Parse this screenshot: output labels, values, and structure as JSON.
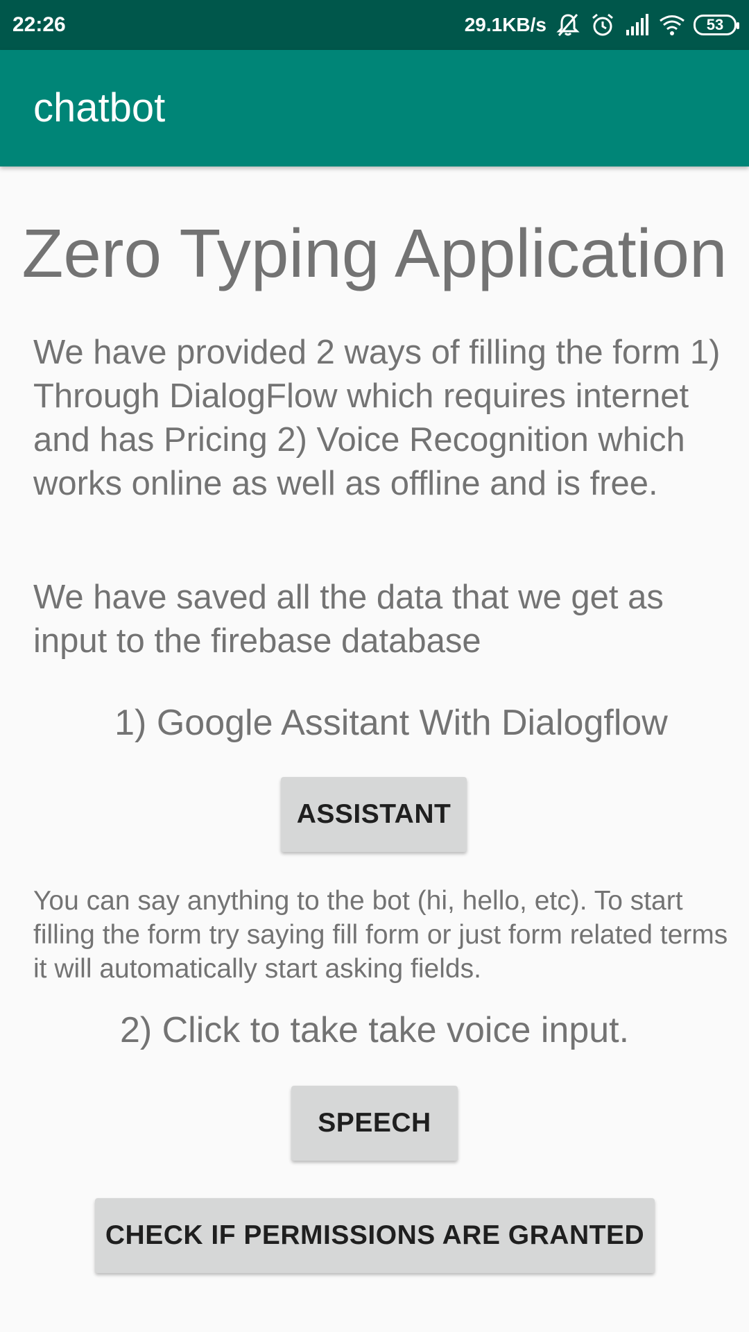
{
  "status_bar": {
    "time": "22:26",
    "network_speed": "29.1KB/s",
    "battery_level": "53",
    "icons": [
      "bell-off-icon",
      "alarm-icon",
      "signal-icon",
      "wifi-icon",
      "battery-icon"
    ]
  },
  "app_bar": {
    "title": "chatbot",
    "color": "#008577"
  },
  "main": {
    "headline": "Zero Typing Application",
    "paragraph_1": "We have provided 2 ways of filling the form 1) Through DialogFlow which requires internet and has Pricing 2) Voice Recognition which works online as well as offline and is free.",
    "paragraph_2": "We have saved all the data that we get as input to the firebase database",
    "section_1_title": "1) Google Assitant With Dialogflow",
    "assistant_button": "ASSISTANT",
    "help_text": "You can say anything to the bot (hi, hello, etc). To start filling the form try saying fill form or just form related terms it will automatically start asking fields.",
    "section_2_title": "2) Click to take take voice input.",
    "speech_button": "SPEECH",
    "permissions_button": "CHECK IF PERMISSIONS ARE GRANTED"
  }
}
